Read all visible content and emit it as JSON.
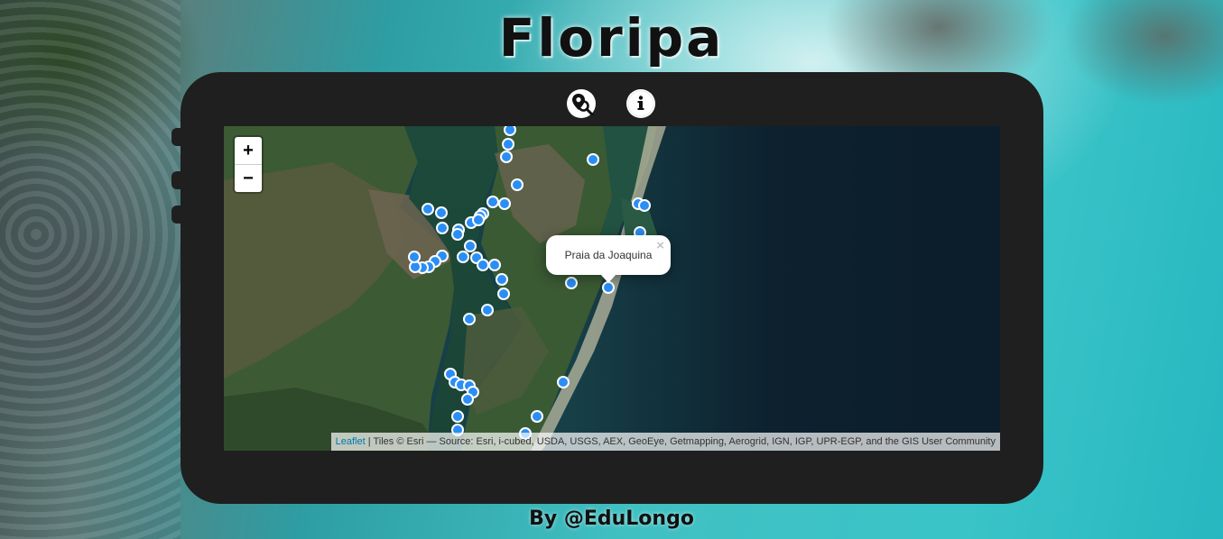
{
  "page": {
    "title": "Floripa",
    "footer": "By @EduLongo"
  },
  "toolbar": {
    "buttons": [
      {
        "icon": "map-pin-search-icon"
      },
      {
        "icon": "info-icon",
        "glyph": "i"
      }
    ]
  },
  "map": {
    "zoom_in_label": "+",
    "zoom_out_label": "−",
    "popup": {
      "text": "Praia da Joaquina",
      "close_label": "×"
    },
    "attribution": {
      "link": "Leaflet",
      "text": " | Tiles © Esri — Source: Esri, i-cubed, USDA, USGS, AEX, GeoEye, Getmapping, Aerogrid, IGN, IGP, UPR-EGP, and the GIS User Community"
    },
    "marker_color": "#2b8ef5"
  },
  "colors": {
    "panel": "#1f1f1f",
    "ocean": "#0c1e2b",
    "marker": "#2b8ef5"
  }
}
